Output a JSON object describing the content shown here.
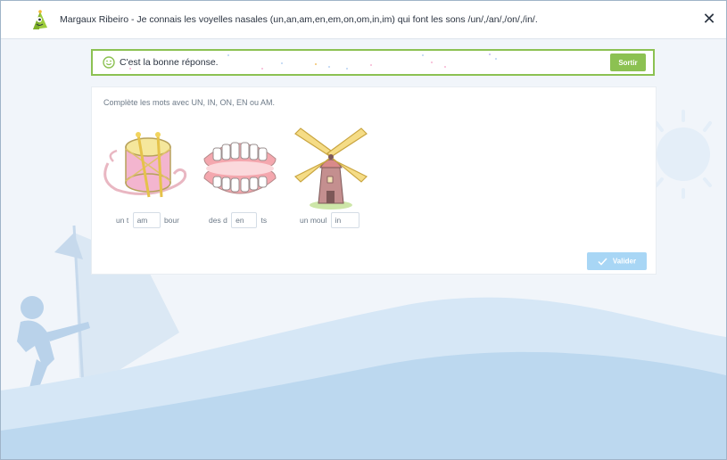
{
  "window": {
    "title": "Margaux Ribeiro - Je connais les voyelles nasales (un,an,am,en,em,on,om,in,im) qui font les sons /un/,/an/,/on/,/in/.",
    "close_symbol": "✕"
  },
  "feedback": {
    "message": "C'est la bonne réponse.",
    "exit_label": "Sortir",
    "icon": "smiley-icon",
    "color": "#8cc152"
  },
  "exercise": {
    "instruction": "Complète les mots avec UN, IN, ON, EN ou AM.",
    "items": [
      {
        "picture": "drum",
        "prefix": "un t",
        "answer": "am",
        "suffix": "bour"
      },
      {
        "picture": "teeth",
        "prefix": "des d",
        "answer": "en",
        "suffix": "ts"
      },
      {
        "picture": "windmill",
        "prefix": "un moul",
        "answer": "in",
        "suffix": ""
      }
    ],
    "validate_label": "Valider",
    "validate_color": "#a8d6f5"
  },
  "colors": {
    "accent_green": "#8cc152",
    "background_blue": "#f1f5fa",
    "wave_blue": "#c5dff3",
    "sun_color": "#ddeaf6"
  }
}
